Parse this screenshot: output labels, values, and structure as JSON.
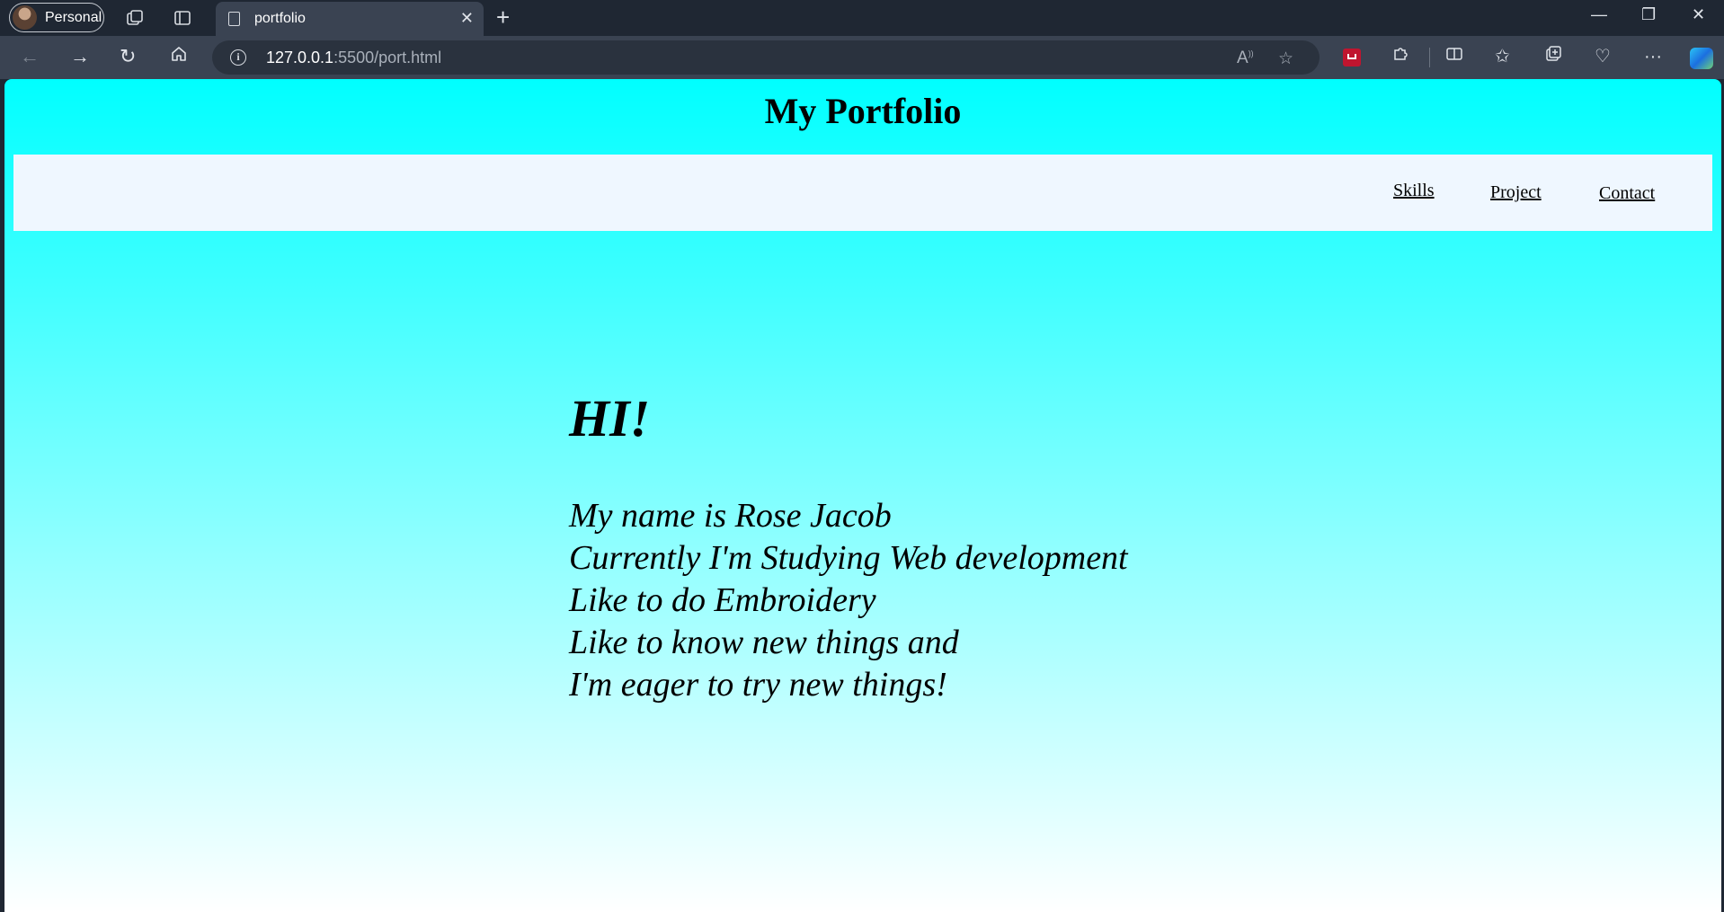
{
  "browser": {
    "profile_label": "Personal",
    "tab": {
      "title": "portfolio"
    },
    "address": {
      "host": "127.0.0.1",
      "path": ":5500/port.html"
    },
    "icons": {
      "workspaces": "workspaces-icon",
      "tab_actions": "tab-actions-icon",
      "read_aloud": "read-aloud-icon",
      "favorite": "star-icon",
      "extensions": "puzzle-icon",
      "split_screen": "split-screen-icon",
      "favorites": "favorites-icon",
      "collections": "collections-icon",
      "performance": "heart-pulse-icon",
      "more": "more-icon",
      "copilot": "copilot-icon"
    }
  },
  "page": {
    "title": "My Portfolio",
    "nav": [
      "Skills",
      "Project",
      "Contact"
    ],
    "greeting": "HI!",
    "bio_lines": [
      "My name is Rose Jacob",
      "Currently I'm Studying Web development",
      "Like to do Embroidery",
      "Like to know new things and",
      "I'm eager to try new things!"
    ],
    "colors": {
      "background_top": "#00ffff",
      "background_bottom": "#ffffff",
      "nav_bar": "#eff7ff"
    }
  }
}
